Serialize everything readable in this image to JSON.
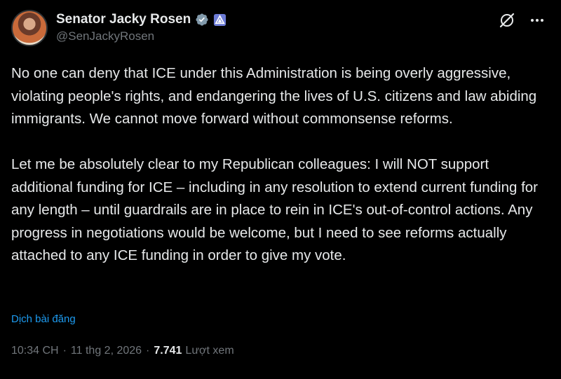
{
  "author": {
    "display_name": "Senator Jacky Rosen",
    "handle": "@SenJackyRosen",
    "verified_badge_color": "#829aab",
    "gov_badge_color": "#6c7bd6"
  },
  "post": {
    "paragraph_1": "No one can deny that ICE under this Administration is being overly aggressive, violating people's rights, and endangering the lives of U.S. citizens and law abiding immigrants. We cannot move forward without commonsense reforms.",
    "paragraph_2": "Let me be absolutely clear to my Republican colleagues: I will NOT support additional funding for ICE – including in any resolution to extend current funding for any length – until guardrails are in place to rein in ICE's out-of-control actions. Any progress in negotiations would be welcome, but I need to see reforms actually attached to any ICE funding in order to give my vote.",
    "translate_label": "Dịch bài đăng"
  },
  "meta": {
    "time": "10:34 CH",
    "date": "11 thg 2, 2026",
    "separator": "·",
    "views_count": "7.741",
    "views_label": "Lượt xem"
  },
  "icons": {
    "grok": "grok-icon",
    "more": "more-options-icon",
    "verified": "verified-badge-icon",
    "gov": "government-badge-icon"
  },
  "colors": {
    "background": "#000000",
    "text": "#e7e9ea",
    "secondary": "#71767b",
    "link": "#1d9bf0"
  }
}
